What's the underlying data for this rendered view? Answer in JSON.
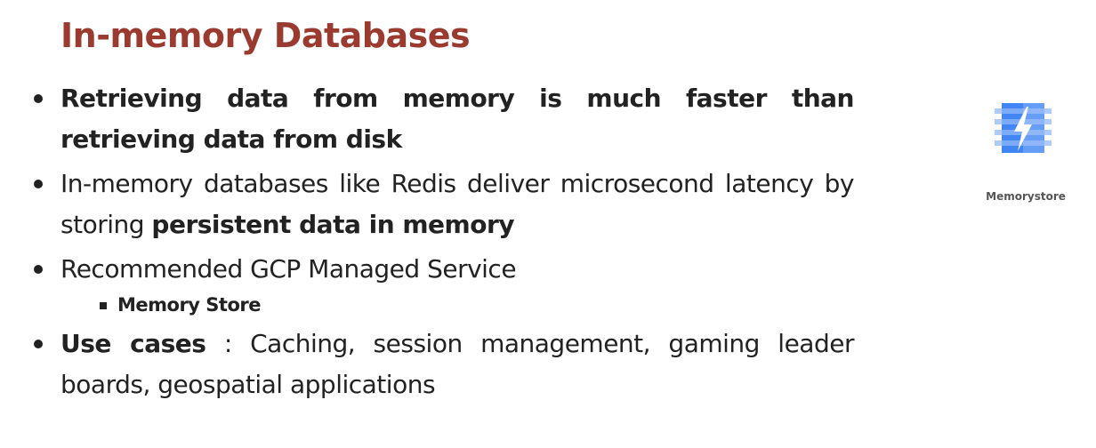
{
  "title": "In-memory Databases",
  "bullets": [
    {
      "text": "Retrieving data from memory is much faster than retrieving data from disk"
    },
    {
      "text_before": "In-memory databases like Redis deliver microsecond latency by storing ",
      "text_bold": "persistent data in memory"
    },
    {
      "text": "Recommended GCP Managed Service",
      "sub_items": [
        "Memory Store"
      ]
    },
    {
      "text_bold": "Use cases",
      "text_after": " : Caching, session management, gaming leader boards, geospatial applications"
    }
  ],
  "logo": {
    "icon": "memorystore-chip-bolt-icon",
    "caption": "Memorystore",
    "colors": {
      "chip_light": "#aecbfa",
      "chip_mid": "#669df6",
      "chip_dark": "#4285f4",
      "bolt": "#ffffff"
    }
  },
  "colors": {
    "title": "#9b3a2f",
    "body_text": "#222222"
  }
}
